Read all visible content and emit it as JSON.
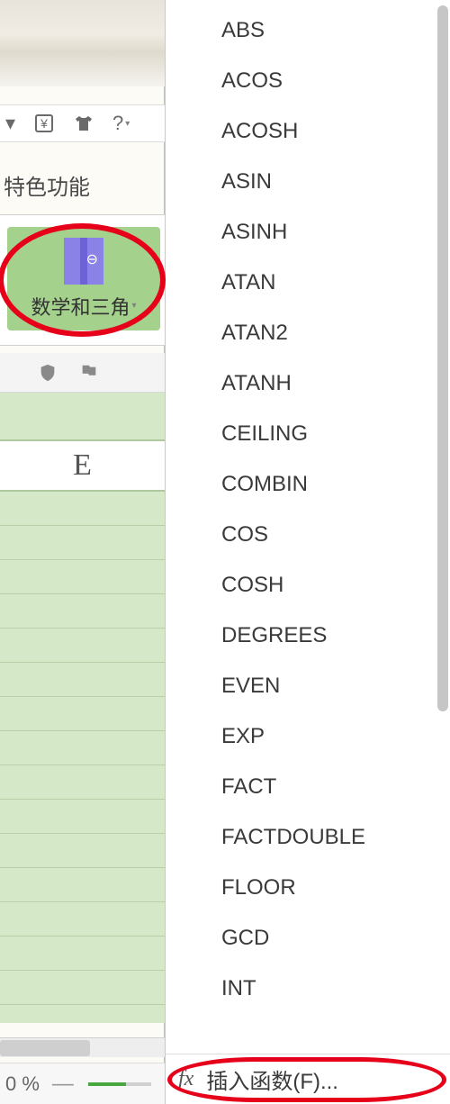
{
  "toolbar": {
    "help_label": "?"
  },
  "tab": {
    "label": "特色功能"
  },
  "category": {
    "label": "数学和三角"
  },
  "column": {
    "header": "E"
  },
  "status": {
    "zoom_text": "0 %"
  },
  "menu": {
    "functions": [
      "ABS",
      "ACOS",
      "ACOSH",
      "ASIN",
      "ASINH",
      "ATAN",
      "ATAN2",
      "ATANH",
      "CEILING",
      "COMBIN",
      "COS",
      "COSH",
      "DEGREES",
      "EVEN",
      "EXP",
      "FACT",
      "FACTDOUBLE",
      "FLOOR",
      "GCD",
      "INT"
    ],
    "footer_fx": "fx",
    "footer_label": "插入函数(F)..."
  }
}
